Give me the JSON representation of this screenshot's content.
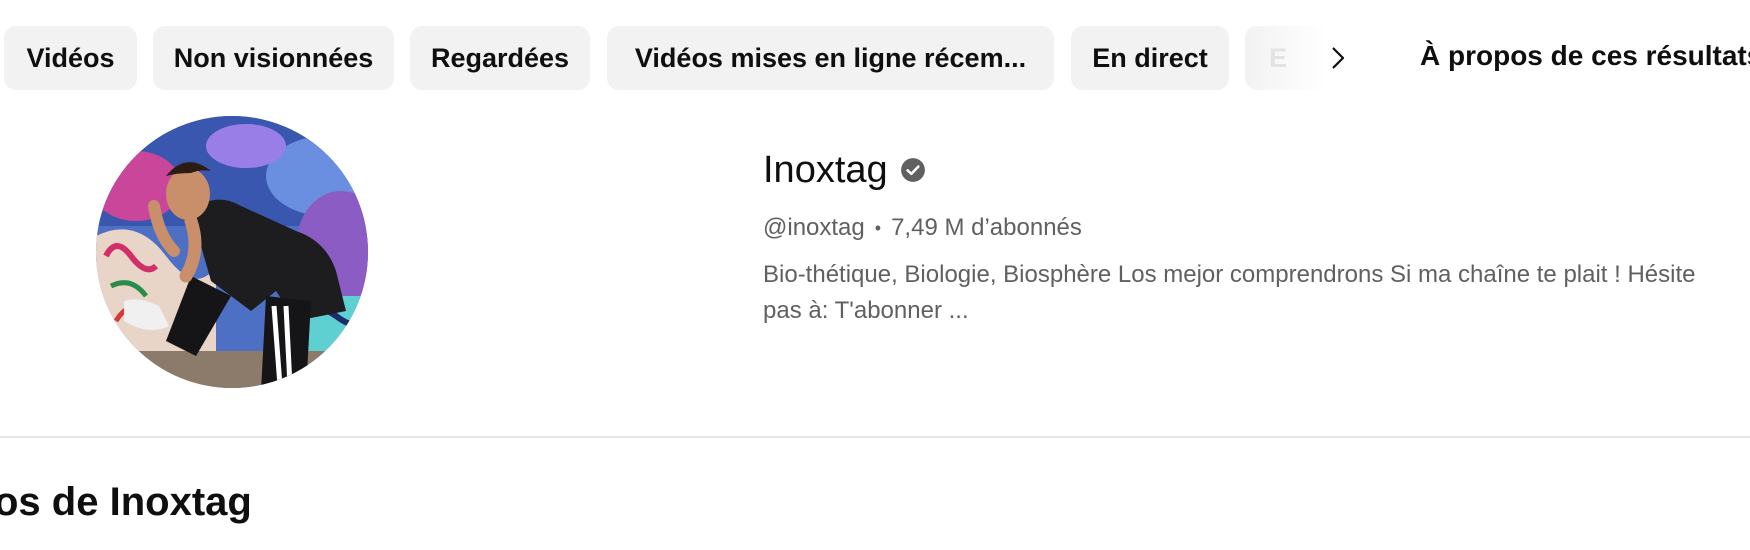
{
  "filter_chips": {
    "chips": [
      {
        "label": "Vidéos"
      },
      {
        "label": "Non visionnées"
      },
      {
        "label": "Regardées"
      },
      {
        "label": "Vidéos mises en ligne récem..."
      },
      {
        "label": "En direct"
      }
    ],
    "partial_chip_label": "E",
    "next_icon": "chevron-right-icon",
    "about_link": "À propos de ces résultats"
  },
  "channel": {
    "name": "Inoxtag",
    "verified_icon": "verified-badge-icon",
    "handle": "@inoxtag",
    "separator": "•",
    "subscribers": "7,49 M d’abonnés",
    "description": "Bio-thétique, Biologie, Biosphère Los mejor comprendrons Si ma chaîne te plait ! Hésite pas à: T'abonner ..."
  },
  "section": {
    "title": "os de Inoxtag"
  },
  "colors": {
    "chip_bg": "#f2f2f2",
    "text_primary": "#0f0f0f",
    "text_secondary": "#606060",
    "divider": "#e5e5e5"
  }
}
